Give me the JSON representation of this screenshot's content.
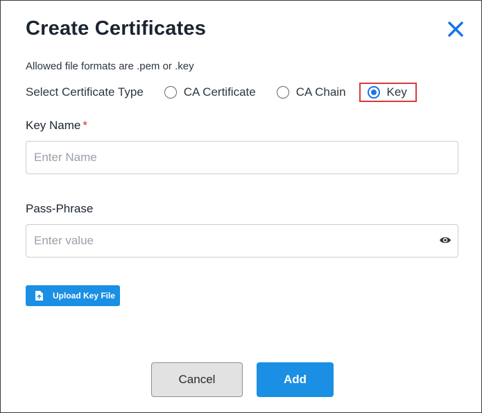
{
  "dialog": {
    "title": "Create Certificates",
    "close_icon": "close-icon",
    "formats_note": "Allowed file formats are .pem or .key"
  },
  "certificate_type": {
    "label": "Select Certificate Type",
    "options": [
      {
        "label": "CA Certificate",
        "selected": false
      },
      {
        "label": "CA Chain",
        "selected": false
      },
      {
        "label": "Key",
        "selected": true
      }
    ],
    "highlight_color": "#d83a3a"
  },
  "key_name": {
    "label": "Key Name",
    "required_marker": "*",
    "placeholder": "Enter Name",
    "value": ""
  },
  "pass_phrase": {
    "label": "Pass-Phrase",
    "placeholder": "Enter value",
    "value": "",
    "toggle_icon": "eye-icon"
  },
  "upload": {
    "label": "Upload Key File",
    "icon": "file-upload-icon"
  },
  "footer": {
    "cancel_label": "Cancel",
    "add_label": "Add"
  },
  "colors": {
    "primary": "#1a8fe3",
    "radio_accent": "#1a73e8",
    "required": "#d32f2f",
    "cancel_bg": "#e2e2e2"
  }
}
